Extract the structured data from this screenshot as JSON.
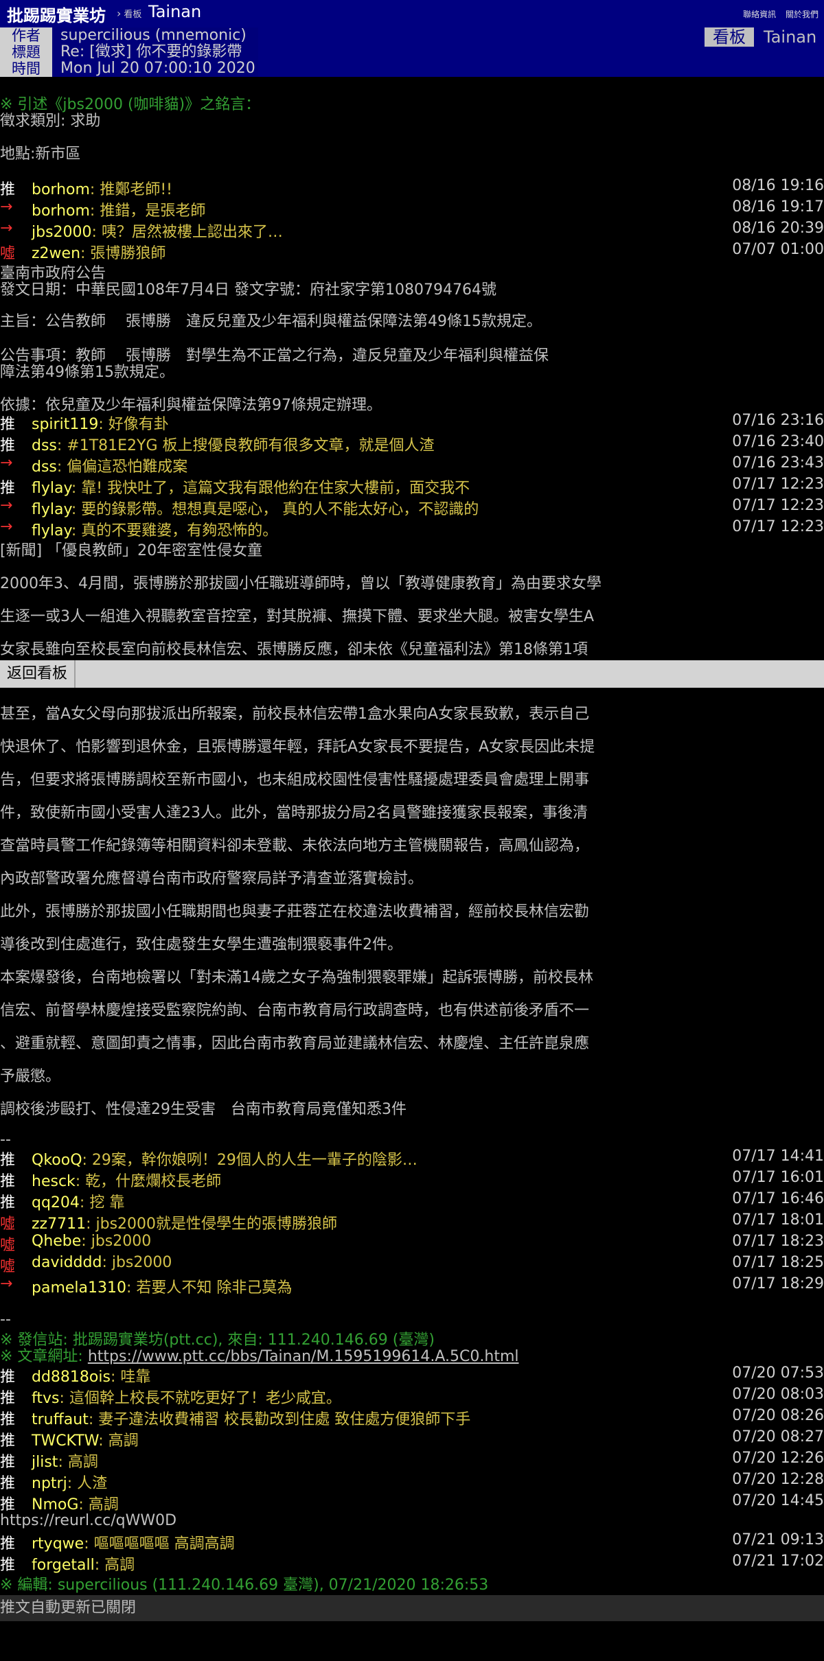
{
  "topbar": {
    "site_name": "批踢踢實業坊",
    "separator": "›",
    "board_label": "看板",
    "board_name": "Tainan",
    "links": [
      "聯絡資訊",
      "關於我們"
    ]
  },
  "meta": {
    "author_label": "作者",
    "author_value": "supercilious (mnemonic)",
    "title_label": "標題",
    "title_value": "Re: [徵求] 你不要的錄影帶",
    "time_label": "時間",
    "time_value": "Mon Jul 20 07:00:10 2020",
    "board_tag": "看板",
    "board_value": "Tainan"
  },
  "content": {
    "quote_header": "※ 引述《jbs2000 (咖啡貓)》之銘言：",
    "lines_a": [
      "徵求類別: 求助",
      "地點:新市區"
    ],
    "pushes_1": [
      {
        "tag": "推",
        "user": "borhom",
        "text": ": 推鄭老師!!",
        "time": "08/16 19:16"
      },
      {
        "tag": "→",
        "user": "borhom",
        "text": ": 推錯，是張老師",
        "time": "08/16 19:17"
      },
      {
        "tag": "→",
        "user": "jbs2000",
        "text": ": 咦？居然被樓上認出來了…",
        "time": "08/16 20:39"
      },
      {
        "tag": "噓",
        "user": "z2wen",
        "text": ": 張博勝狼師",
        "time": "07/07 01:00"
      }
    ],
    "lines_b": [
      "臺南市政府公告",
      "發文日期：中華民國108年7月4日 發文字號：府社家字第1080794764號",
      "主旨：公告教師　 張博勝　違反兒童及少年福利與權益保障法第49條15款規定。",
      "公告事項：教師　 張博勝　對學生為不正當之行為，違反兒童及少年福利與權益保",
      "障法第49條第15款規定。",
      "依據：依兒童及少年福利與權益保障法第97條規定辦理。"
    ],
    "pushes_2": [
      {
        "tag": "推",
        "user": "spirit119",
        "text": ": 好像有卦",
        "time": "07/16 23:16"
      },
      {
        "tag": "推",
        "user": "dss",
        "text": ": #1T81E2YG  板上搜優良教師有很多文章，就是個人渣",
        "time": "07/16 23:40"
      },
      {
        "tag": "→",
        "user": "dss",
        "text": ": 偏偏這恐怕難成案",
        "time": "07/16 23:43"
      },
      {
        "tag": "推",
        "user": "flylay",
        "text": ": 靠! 我快吐了，這篇文我有跟他約在住家大樓前，面交我不",
        "time": "07/17 12:23"
      },
      {
        "tag": "→",
        "user": "flylay",
        "text": ": 要的錄影帶。想想真是噁心， 真的人不能太好心，不認識的",
        "time": "07/17 12:23"
      },
      {
        "tag": "→",
        "user": "flylay",
        "text": ": 真的不要雞婆，有夠恐怖的。",
        "time": "07/17 12:23"
      }
    ],
    "news_lines": [
      "[新聞] 「優良教師」20年密室性侵女童",
      "2000年3、4月間，張博勝於那拔國小任職班導師時，曾以「教導健康教育」為由要求女學",
      "生逐一或3人一組進入視聽教室音控室，對其脫褲、撫摸下體、要求坐大腿。被害女學生A",
      "女家長雖向至校長室向前校長林信宏、張博勝反應，卻未依《兒童福利法》第18條第1項"
    ],
    "back_button": "返回看板",
    "news_lines_2": [
      "甚至，當A女父母向那拔派出所報案，前校長林信宏帶1盒水果向A女家長致歉，表示自己",
      "快退休了、怕影響到退休金，且張博勝還年輕，拜託A女家長不要提告，A女家長因此未提",
      "告，但要求將張博勝調校至新市國小，也未組成校園性侵害性騷擾處理委員會處理上開事",
      "件，致使新市國小受害人達23人。此外，當時那拔分局2名員警雖接獲家長報案，事後清",
      "查當時員警工作紀錄簿等相關資料卻未登載、未依法向地方主管機關報告，高鳳仙認為，",
      "內政部警政署允應督導台南市政府警察局詳予清查並落實檢討。",
      "此外，張博勝於那拔國小任職期間也與妻子莊蓉芷在校違法收費補習，經前校長林信宏勸",
      "導後改到住處進行，致住處發生女學生遭強制猥褻事件2件。",
      "本案爆發後，台南地檢署以「對未滿14歲之女子為強制猥褻罪嫌」起訴張博勝，前校長林",
      "信宏、前督學林慶煌接受監察院約詢、台南市教育局行政調查時，也有供述前後矛盾不一",
      "、避重就輕、意圖卸責之情事，因此台南市教育局並建議林信宏、林慶煌、主任許崑泉應",
      "予嚴懲。",
      "調校後涉毆打、性侵達29生受害　台南市教育局竟僅知悉3件"
    ],
    "dashdash": "--",
    "pushes_3": [
      {
        "tag": "推",
        "user": "QkooQ",
        "text": ": 29案，幹你娘咧！29個人的人生一輩子的陰影…",
        "time": "07/17 14:41"
      },
      {
        "tag": "推",
        "user": "hesck",
        "text": ": 乾，什麼爛校長老師",
        "time": "07/17 16:01"
      },
      {
        "tag": "推",
        "user": "qq204",
        "text": ": 挖 靠",
        "time": "07/17 16:46"
      },
      {
        "tag": "噓",
        "user": "zz7711",
        "text": ": jbs2000就是性侵學生的張博勝狼師",
        "time": "07/17 18:01"
      },
      {
        "tag": "噓",
        "user": "Qhebe",
        "text": ": jbs2000",
        "time": "07/17 18:23"
      },
      {
        "tag": "噓",
        "user": "davidddd",
        "text": ": jbs2000",
        "time": "07/17 18:25"
      },
      {
        "tag": "→",
        "user": "pamela1310",
        "text": ": 若要人不知 除非己莫為",
        "time": "07/17 18:29"
      }
    ],
    "dashdash2": "--",
    "sent_from": "※ 發信站: 批踢踢實業坊(ptt.cc), 來自: 111.240.146.69 (臺灣)",
    "url_label": "※ 文章網址: ",
    "url": "https://www.ptt.cc/bbs/Tainan/M.1595199614.A.5C0.html",
    "pushes_4": [
      {
        "tag": "推",
        "user": "dd8818ois",
        "text": ": 哇靠",
        "time": "07/20 07:53"
      },
      {
        "tag": "推",
        "user": "ftvs",
        "text": ": 這個幹上校長不就吃更好了！老少咸宜。",
        "time": "07/20 08:03"
      },
      {
        "tag": "推",
        "user": "truffaut",
        "text": ": 妻子違法收費補習 校長勸改到住處 致住處方便狼師下手",
        "time": "07/20 08:26"
      },
      {
        "tag": "推",
        "user": "TWCKTW",
        "text": ": 高調",
        "time": "07/20 08:27"
      },
      {
        "tag": "推",
        "user": "jlist",
        "text": ": 高調",
        "time": "07/20 12:26"
      },
      {
        "tag": "推",
        "user": "nptrj",
        "text": ": 人渣",
        "time": "07/20 12:28"
      },
      {
        "tag": "推",
        "user": "NmoG",
        "text": ": 高調",
        "time": "07/20 14:45"
      }
    ],
    "short_url": "https://reurl.cc/qWW0D",
    "pushes_5": [
      {
        "tag": "推",
        "user": "rtyqwe",
        "text": ": 嘔嘔嘔嘔嘔 高調高調",
        "time": "07/21 09:13"
      },
      {
        "tag": "推",
        "user": "forgetall",
        "text": ": 高調",
        "time": "07/21 17:02"
      }
    ],
    "edit_note": "※ 編輯: supercilious (111.240.146.69 臺灣), 07/21/2020 18:26:53",
    "footer": "推文自動更新已關閉"
  }
}
